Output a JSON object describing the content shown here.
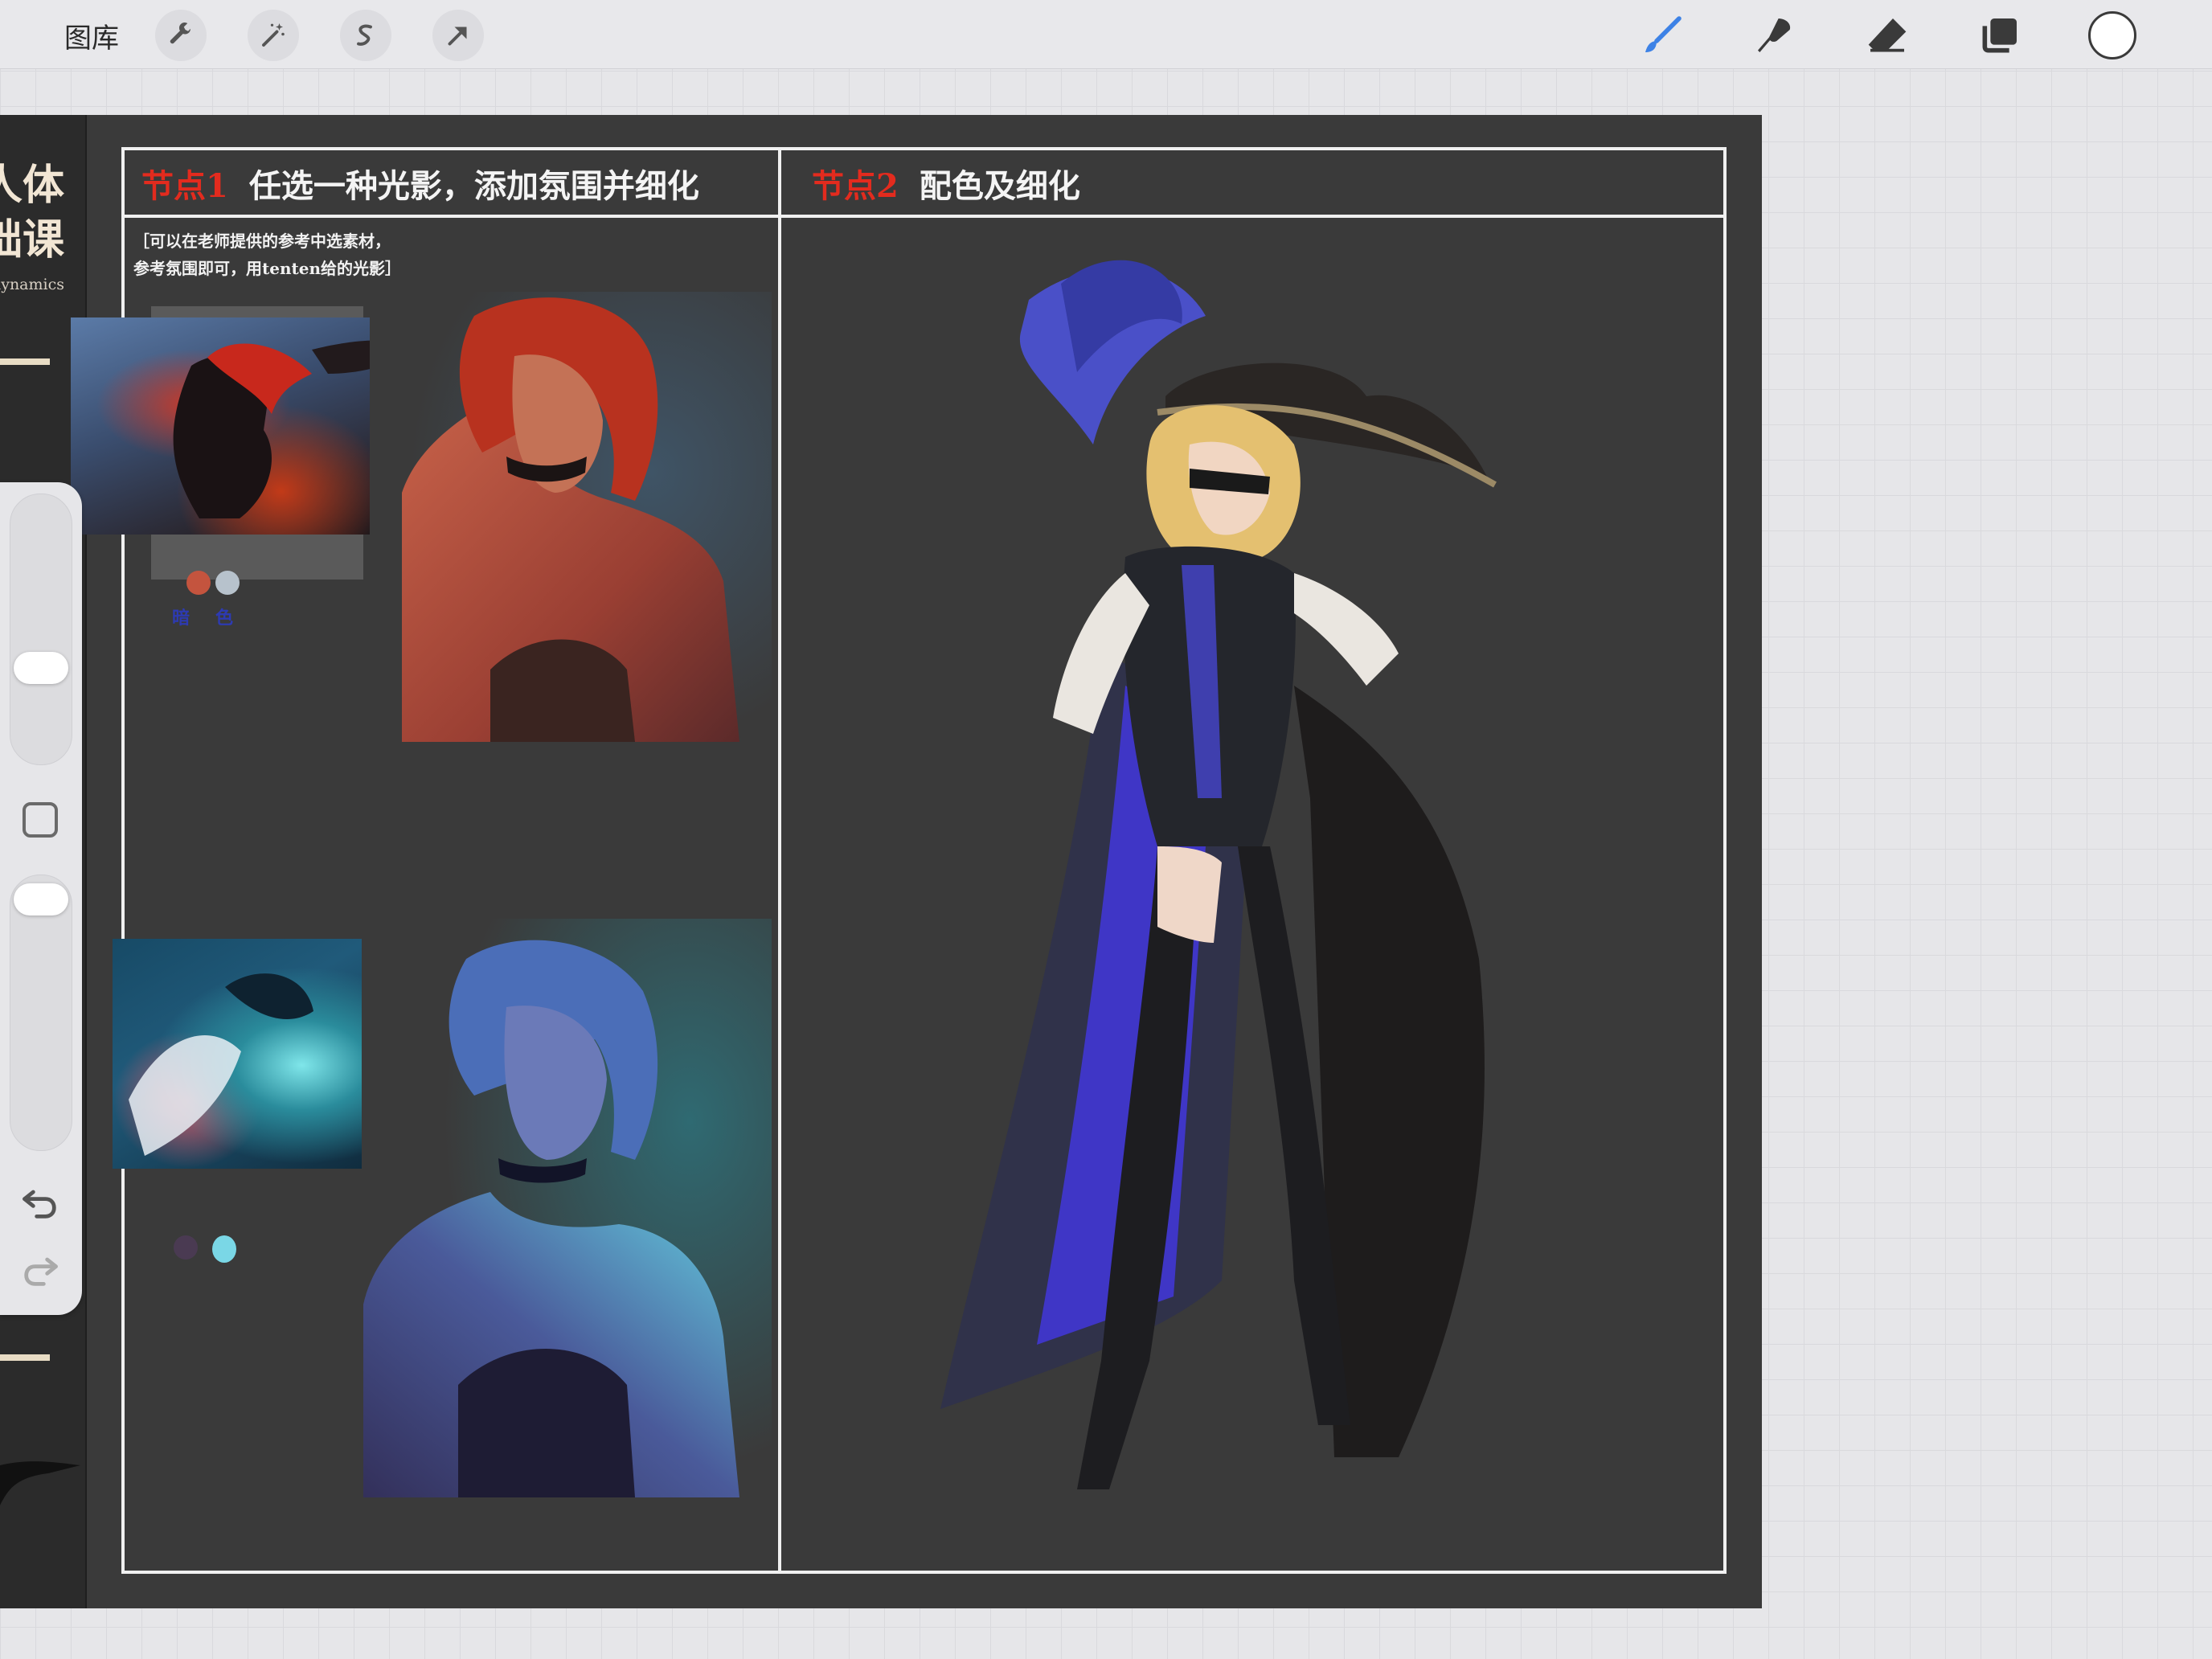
{
  "toolbar": {
    "gallery_label": "图库",
    "left_tools": [
      "wrench-icon",
      "magic-wand-icon",
      "selection-icon",
      "transform-arrow-icon"
    ],
    "right_tools": [
      "brush-icon",
      "smudge-icon",
      "eraser-icon",
      "layers-icon"
    ],
    "brush_color": "#3d82e6",
    "current_color": "#ffffff"
  },
  "canvas": {
    "left_strip": {
      "title_line1": "人体",
      "title_line2": "础课",
      "subtitle": "e dynamics"
    },
    "node1": {
      "tag": "节点1",
      "title": "任选一种光影，添加氛围并细化",
      "note_line1": "［可以在老师提供的参考中选素材，",
      "note_line2": "参考氛围即可，用tenten给的光影］",
      "swatch_labels": [
        "暗",
        "色"
      ],
      "swatches_top": [
        "#c4543e",
        "#b7c2cc"
      ],
      "swatches_bottom": [
        "#4a3a52",
        "#7ad7e6"
      ]
    },
    "node2": {
      "tag": "节点2",
      "title": "配色及细化"
    },
    "colors": {
      "accent_red": "#e32b1e",
      "canvas_bg": "#3a3a3a"
    }
  },
  "sidebar": {
    "size_slider_level": 0.38,
    "opacity_slider_level": 0.9,
    "undo_icon": "undo-icon",
    "redo_icon": "redo-icon"
  }
}
